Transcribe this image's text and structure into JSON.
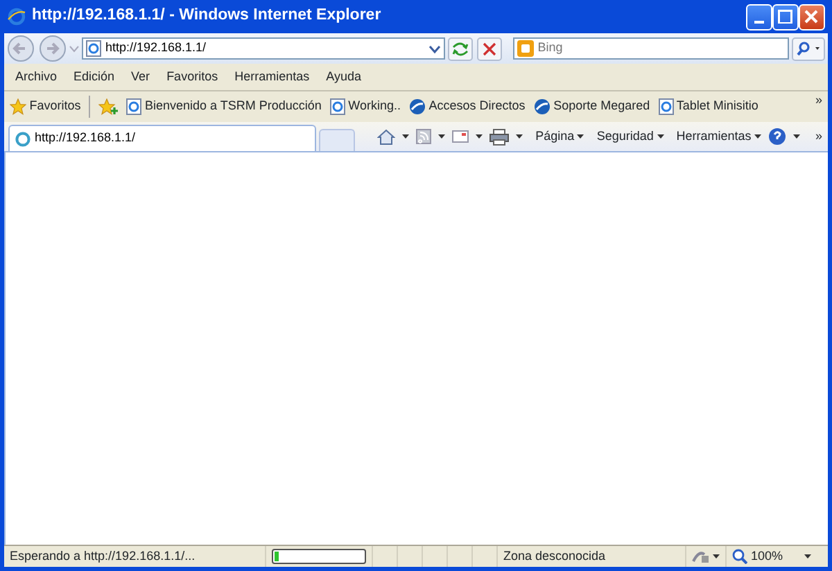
{
  "window": {
    "title": "http://192.168.1.1/ - Windows Internet Explorer"
  },
  "address_bar": {
    "value": "http://192.168.1.1/"
  },
  "search": {
    "placeholder": "Bing"
  },
  "menu": [
    "Archivo",
    "Edición",
    "Ver",
    "Favoritos",
    "Herramientas",
    "Ayuda"
  ],
  "favorites_bar": {
    "label": "Favoritos",
    "overflow": "»",
    "links": [
      {
        "label": "Bienvenido a TSRM Producción",
        "kind": "page"
      },
      {
        "label": "Working..",
        "kind": "page"
      },
      {
        "label": "Accesos Directos",
        "kind": "globe"
      },
      {
        "label": "Soporte Megared",
        "kind": "globe"
      },
      {
        "label": "Tablet Minisitio",
        "kind": "page"
      }
    ]
  },
  "tabs": [
    {
      "label": "http://192.168.1.1/",
      "selected": true
    }
  ],
  "command_bar": {
    "overflow": "»",
    "items": [
      {
        "kind": "home"
      },
      {
        "kind": "feeds"
      },
      {
        "kind": "mail"
      },
      {
        "kind": "print"
      },
      {
        "kind": "menu",
        "label": "Página"
      },
      {
        "kind": "menu",
        "label": "Seguridad"
      },
      {
        "kind": "menu",
        "label": "Herramientas"
      },
      {
        "kind": "help"
      }
    ]
  },
  "status_bar": {
    "text": "Esperando a http://192.168.1.1/...",
    "progress": {
      "level": 0.04
    },
    "zone": "Zona desconocida",
    "zoom": "100%"
  }
}
